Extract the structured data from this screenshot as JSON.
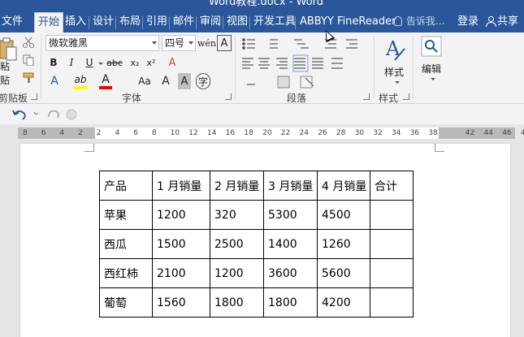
{
  "window": {
    "title": "Word教程.docx - Word"
  },
  "tabs": [
    {
      "label": "文件",
      "active": false
    },
    {
      "label": "开始",
      "active": true
    },
    {
      "label": "插入",
      "active": false
    },
    {
      "label": "设计",
      "active": false
    },
    {
      "label": "布局",
      "active": false
    },
    {
      "label": "引用",
      "active": false
    },
    {
      "label": "邮件",
      "active": false
    },
    {
      "label": "审阅",
      "active": false
    },
    {
      "label": "视图",
      "active": false
    },
    {
      "label": "开发工具",
      "active": false
    },
    {
      "label": "ABBYY FineReader",
      "active": false
    }
  ],
  "tell_me": "告诉我...",
  "login": "登录",
  "share": "共享",
  "ribbon": {
    "clipboard": {
      "paste_label": "粘贴",
      "group_label": "剪贴板"
    },
    "font": {
      "font_name": "微软雅黑",
      "font_size": "四号",
      "grow_label": "A",
      "shrink_label": "A",
      "phonetic_label": "wén",
      "border_label": "A",
      "bold": "B",
      "italic": "I",
      "underline": "U",
      "strike": "abc",
      "subscript": "x₂",
      "superscript": "x²",
      "clear_label": "A",
      "effects_label": "A",
      "highlight_label": "ab",
      "color_label": "A",
      "case_label": "Aa",
      "grow2_label": "A",
      "shade_label": "A",
      "enclose_label": "字",
      "group_label": "字体"
    },
    "paragraph": {
      "group_label": "段落"
    },
    "styles": {
      "label": "样式",
      "group_label": "样式"
    },
    "editing": {
      "label": "编辑"
    }
  },
  "ruler": {
    "ticks": [
      "8",
      "6",
      "4",
      "2",
      "2",
      "4",
      "6",
      "8",
      "10",
      "12",
      "14",
      "16",
      "18",
      "20",
      "22",
      "24",
      "26",
      "28",
      "30",
      "32",
      "34",
      "36",
      "38",
      "42",
      "44",
      "46",
      "48"
    ]
  },
  "colors": {
    "accent": "#2b579a",
    "highlight": "#ffff00",
    "font_color": "#ff0000"
  },
  "table": {
    "header": [
      "产品",
      "1 月销量",
      "2 月销量",
      "3 月销量",
      "4 月销量",
      "合计"
    ],
    "rows": [
      [
        "苹果",
        "1200",
        "320",
        "5300",
        "4500",
        ""
      ],
      [
        "西瓜",
        "1500",
        "2500",
        "1400",
        "1260",
        ""
      ],
      [
        "西红柿",
        "2100",
        "1200",
        "3600",
        "5600",
        ""
      ],
      [
        "葡萄",
        "1560",
        "1800",
        "1800",
        "4200",
        ""
      ]
    ]
  }
}
